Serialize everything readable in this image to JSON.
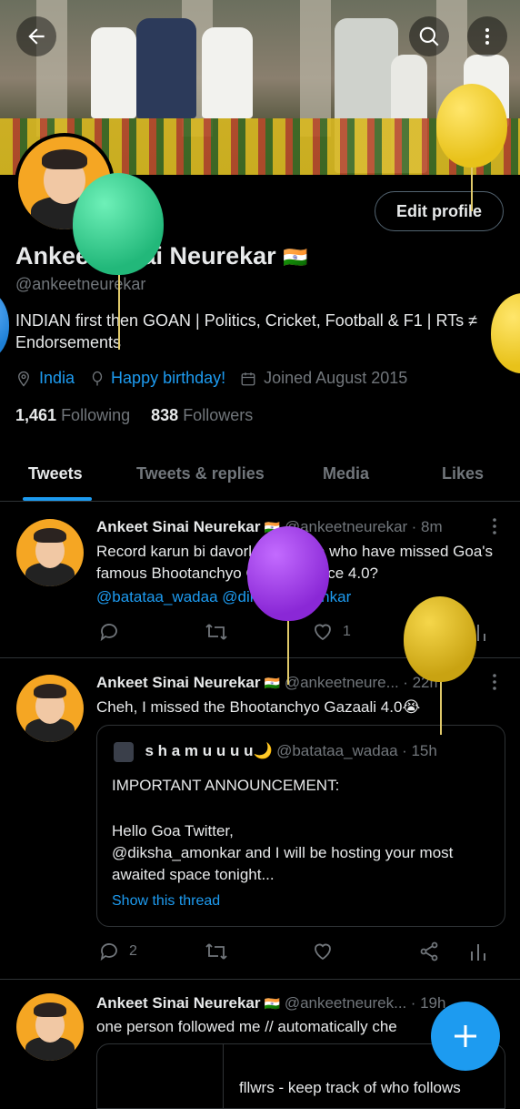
{
  "profile": {
    "name": "Ankeet Sinai Neurekar",
    "flag": "🇮🇳",
    "handle": "@ankeetneurekar",
    "bio": "INDIAN first then GOAN | Politics, Cricket, Football & F1 | RTs ≠ Endorsements",
    "location": "India",
    "birthday": "Happy birthday!",
    "joined": "Joined August 2015",
    "following_count": "1,461",
    "following_label": "Following",
    "followers_count": "838",
    "followers_label": "Followers",
    "edit_label": "Edit profile"
  },
  "tabs": [
    "Tweets",
    "Tweets & replies",
    "Media",
    "Likes"
  ],
  "tweets": [
    {
      "name": "Ankeet Sinai Neurekar",
      "flag": "🇮🇳",
      "handle": "@ankeetneurekar",
      "time": "· 8m",
      "text": "Record karun bi davorla for those who have missed Goa's famous Bhootanchyo Gazaali space 4.0?",
      "links": "@batataa_wadaa @diksha_amonkar",
      "likes": "1"
    },
    {
      "name": "Ankeet Sinai Neurekar",
      "flag": "🇮🇳",
      "handle": "@ankeetneure...",
      "time": "· 22m",
      "text": "Cheh, I missed the Bhootanchyo Gazaali 4.0😭",
      "replies": "2",
      "quote": {
        "name": "s h a m u u u u🌙",
        "handle": "@batataa_wadaa",
        "time": "· 15h",
        "line1": "IMPORTANT ANNOUNCEMENT:",
        "line2": "Hello Goa Twitter,",
        "line3": "@diksha_amonkar and I will be hosting your most awaited space tonight...",
        "show_thread": "Show this thread"
      }
    },
    {
      "name": "Ankeet Sinai Neurekar",
      "flag": "🇮🇳",
      "handle": "@ankeetneurek...",
      "time": "· 19h",
      "text": "one person followed me // automatically che",
      "card_text": "fllwrs - keep track of who follows"
    }
  ],
  "colors": {
    "accent": "#1d9bf0",
    "bg": "#000000",
    "muted": "#71767b"
  },
  "balloons": [
    "green-balloon",
    "yellow-balloon",
    "purple-balloon",
    "gold-balloon",
    "blue-balloon"
  ]
}
